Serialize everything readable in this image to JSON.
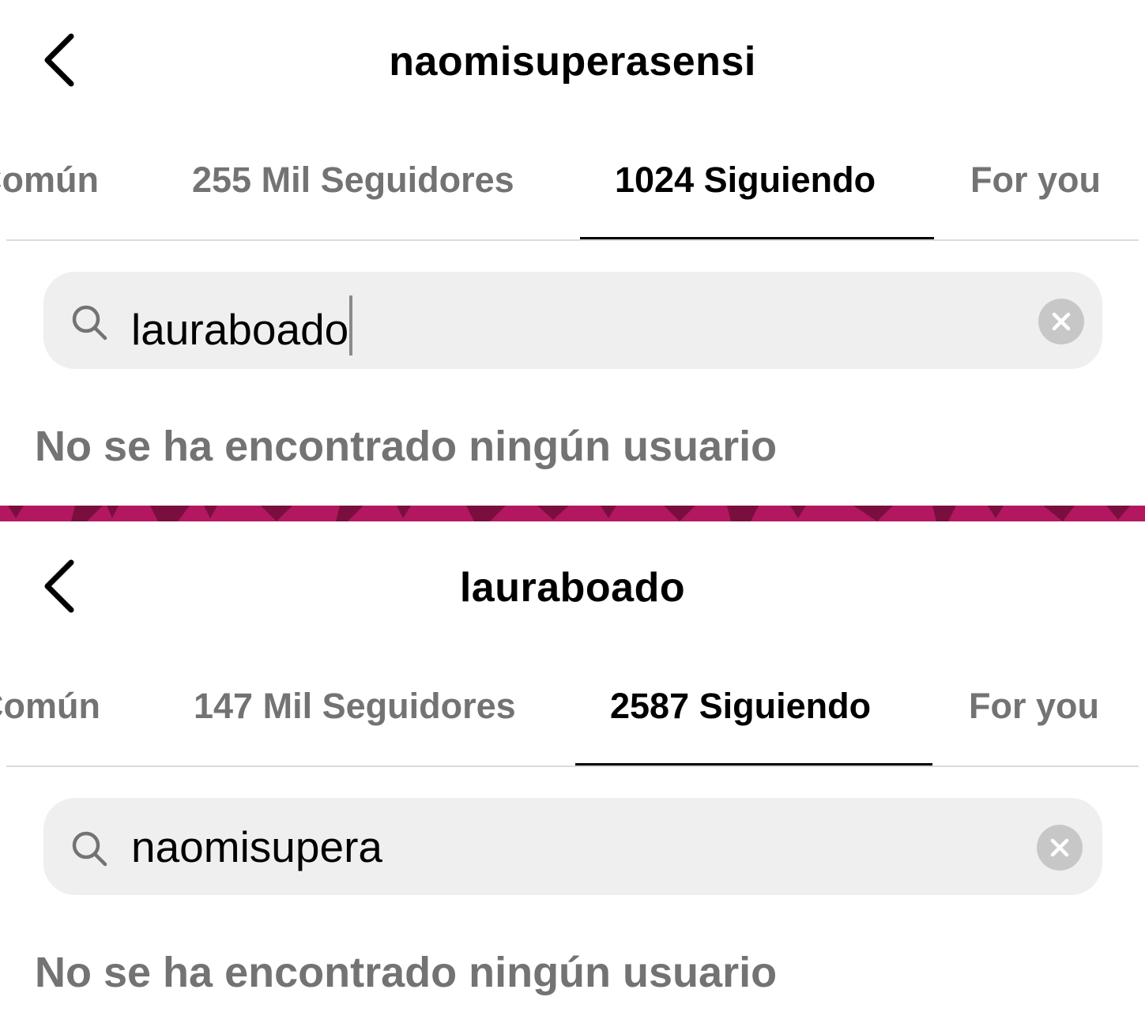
{
  "panels": [
    {
      "title": "naomisuperasensi",
      "tabs": [
        "Común",
        "255 Mil Seguidores",
        "1024 Siguiendo",
        "For you"
      ],
      "active_tab": 2,
      "search_value": "lauraboado",
      "message": "No se ha encontrado ningún usuario"
    },
    {
      "title": "lauraboado",
      "tabs": [
        "Común",
        "147 Mil Seguidores",
        "2587 Siguiendo",
        "For you"
      ],
      "active_tab": 2,
      "search_value": "naomisupera",
      "message": "No se ha encontrado ningún usuario"
    }
  ],
  "colors": {
    "divider_band": "#b3175f",
    "divider_dark": "#7a0f3f",
    "search_bg": "#efefef",
    "muted_text": "#737373"
  }
}
